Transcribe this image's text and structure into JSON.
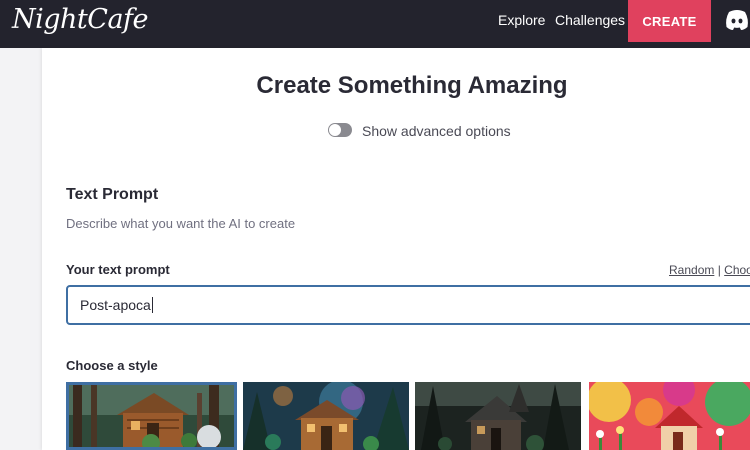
{
  "header": {
    "logo_text": "NightCafe",
    "nav": {
      "explore": "Explore",
      "challenges": "Challenges"
    },
    "create_label": "CREATE",
    "discord_icon": "discord-icon",
    "accent_color": "#e0415e",
    "bg_color": "#23232d"
  },
  "main": {
    "title": "Create Something Amazing",
    "advanced_toggle": {
      "label": "Show advanced options",
      "checked": false
    }
  },
  "text_prompt": {
    "section_title": "Text Prompt",
    "description": "Describe what you want the AI to create",
    "field_label": "Your text prompt",
    "random_link": "Random",
    "separator": "|",
    "choose_link": "Choose",
    "value": "Post-apoca"
  },
  "style": {
    "label": "Choose a style",
    "thumbnails": [
      "cabin-forest-painting",
      "cabin-glowing-night",
      "dark-cabin-misty-forest",
      "colorful-whimsical-house"
    ],
    "selected_index": 0
  }
}
